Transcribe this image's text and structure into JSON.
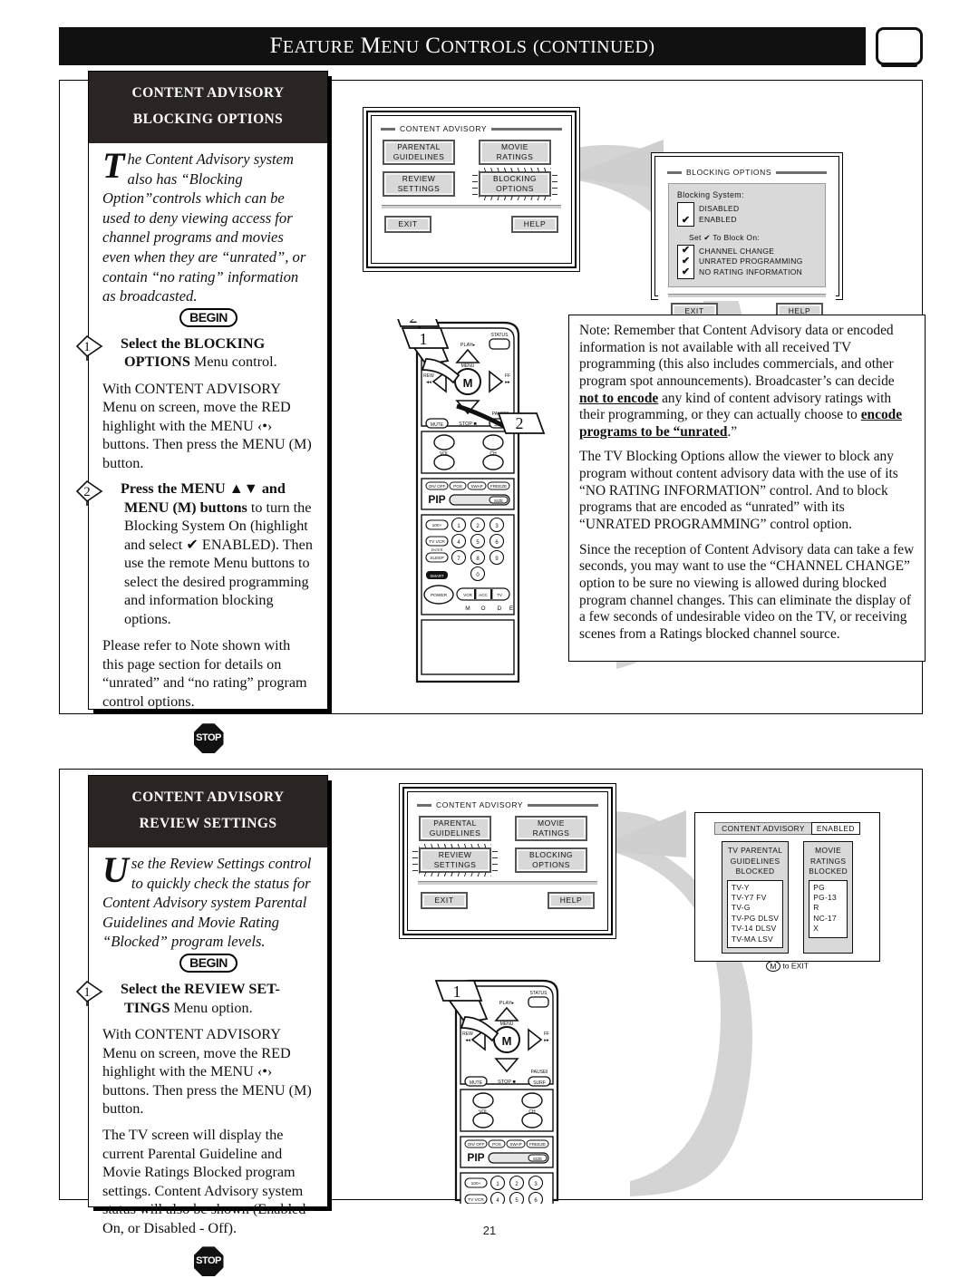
{
  "header": {
    "title_parts": [
      {
        "t": "F",
        "cap": true
      },
      {
        "t": "EATURE",
        "cap": false
      },
      {
        "t": " ",
        "cap": false
      },
      {
        "t": "M",
        "cap": true
      },
      {
        "t": "ENU",
        "cap": false
      },
      {
        "t": " ",
        "cap": false
      },
      {
        "t": "C",
        "cap": true
      },
      {
        "t": "ONTROLS",
        "cap": false
      },
      {
        "t": " (",
        "cap": false
      },
      {
        "t": "CONTINUED",
        "cap": false
      },
      {
        "t": ")",
        "cap": false
      }
    ],
    "title_text": "FEATURE MENU CONTROLS (CONTINUED)",
    "tv_icon": "tv-outline-icon"
  },
  "page_number": "21",
  "sections": [
    {
      "id": "blocking",
      "head_line1": "CONTENT ADVISORY",
      "head_line2": "BLOCKING OPTIONS",
      "intro_dropcap": "T",
      "intro_text": "he Content Advisory system also has “Blocking Option”controls which can be used to deny viewing access for channel programs and movies even when they are “unrated”, or contain “no rating” information as broadcasted.",
      "begin_label": "BEGIN",
      "stop_label": "STOP",
      "steps": [
        {
          "num": "1",
          "bold_lead": "Select the BLOCKING OPTIONS",
          "rest": " Menu control."
        },
        {
          "num": "2",
          "bold_lead": "Press the MENU ▲▼ and MENU (M) buttons",
          "rest": " to turn the Blocking System On (highlight and select ✔ ENABLED). Then use the remote Menu buttons to select the desired programming and information blocking options."
        }
      ],
      "paragraphs": [
        "With CONTENT ADVISORY Menu on screen, move the RED highlight with the MENU ‹•› buttons. Then press the MENU (M) button.",
        "Please refer to Note shown with this page section for details on “unrated” and “no rating” program control options."
      ]
    },
    {
      "id": "review",
      "head_line1": "CONTENT ADVISORY",
      "head_line2": "REVIEW SETTINGS",
      "intro_dropcap": "U",
      "intro_text": "se the Review Settings control to quickly check the status for Content Advisory system Parental Guidelines and Movie Rating “Blocked” program levels.",
      "begin_label": "BEGIN",
      "stop_label": "STOP",
      "steps": [
        {
          "num": "1",
          "bold_lead": "Select the REVIEW SET-TINGS",
          "rest": " Menu option."
        }
      ],
      "paragraphs": [
        "With CONTENT ADVISORY Menu on screen, move the RED highlight with the MENU ‹•› buttons. Then press the MENU (M) button.",
        "The TV screen will display the current Parental Guideline and Movie Ratings Blocked program settings. Content Advisory system status will also be shown (Enabled -On, or Disabled - Off)."
      ]
    }
  ],
  "osd_content_advisory": {
    "legend": "CONTENT ADVISORY",
    "buttons": [
      {
        "l1": "PARENTAL",
        "l2": "GUIDELINES"
      },
      {
        "l1": "MOVIE",
        "l2": "RATINGS"
      },
      {
        "l1": "REVIEW",
        "l2": "SETTINGS"
      },
      {
        "l1": "BLOCKING",
        "l2": "OPTIONS"
      }
    ],
    "exit": "EXIT",
    "help": "HELP",
    "selected_top": "BLOCKING OPTIONS",
    "selected_bottom": "REVIEW SETTINGS"
  },
  "osd_blocking_options": {
    "legend": "BLOCKING OPTIONS",
    "system_label": "Blocking System:",
    "system_options": [
      {
        "label": "DISABLED",
        "checked": false,
        "highlighted": false
      },
      {
        "label": "ENABLED",
        "checked": true,
        "highlighted": true
      }
    ],
    "block_on_label": "Set ✔ To Block On:",
    "block_options": [
      {
        "label": "CHANNEL CHANGE",
        "checked": true,
        "highlighted": false
      },
      {
        "label": "UNRATED PROGRAMMING",
        "checked": true,
        "highlighted": false
      },
      {
        "label": "NO RATING INFORMATION",
        "checked": true,
        "highlighted": true
      }
    ],
    "exit": "EXIT",
    "help": "HELP"
  },
  "osd_review_settings": {
    "status_label": "CONTENT ADVISORY",
    "status_value": "ENABLED",
    "tv_col": {
      "head": [
        "TV PARENTAL",
        "GUIDELINES",
        "BLOCKED"
      ],
      "items": [
        "TV-Y",
        "TV-Y7 FV",
        "TV-G",
        "TV-PG DLSV",
        "TV-14 DLSV",
        "TV-MA  LSV"
      ]
    },
    "movie_col": {
      "head": [
        "MOVIE",
        "RATINGS",
        "BLOCKED"
      ],
      "items": [
        "PG",
        "PG-13",
        "R",
        "NC-17",
        "X"
      ]
    },
    "exit_hint_icon": "M",
    "exit_hint": "to EXIT"
  },
  "note_box": {
    "paragraphs": [
      {
        "runs": [
          {
            "t": "Note: Remember that Content Advisory data or encoded information is not available with all received TV programming (this also includes commercials, and other program spot announcements). Broadcaster’s can decide ",
            "b": false
          },
          {
            "t": "not to encode",
            "b": true
          },
          {
            "t": " any kind of content advisory ratings with their programming, or they can actually choose to ",
            "b": false
          },
          {
            "t": "encode programs to be “unrated",
            "b": true
          },
          {
            "t": ".”",
            "b": false
          }
        ]
      },
      {
        "runs": [
          {
            "t": "The TV Blocking Options allow the viewer to block any program without content advisory data with the use of its “NO RATING INFORMATION” control. And to block programs that are encoded as “unrated” with its “UNRATED PROGRAMMING” control option.",
            "b": false
          }
        ]
      },
      {
        "runs": [
          {
            "t": "Since the reception of Content Advisory data can take a few seconds, you may want to use the “CHANNEL CHANGE” option to be sure no viewing is allowed during blocked program channel changes. This can eliminate the display of a few seconds of undesirable video on the TV, or receiving scenes from a Ratings blocked channel source.",
            "b": false
          }
        ]
      }
    ]
  },
  "remote": {
    "labels": {
      "play": "PLAY▸",
      "status": "STATUS",
      "rew": "REW",
      "rew_sym": "◂◂",
      "ff": "FF",
      "ff_sym": "▸▸",
      "menu": "MENU",
      "m": "M",
      "mute": "MUTE",
      "stop": "STOP",
      "stop_sym": "■",
      "pause": "PAUSE‖",
      "surf": "SURF",
      "vol": "VOL",
      "ch": "CH",
      "onoff": "ON/ OFF",
      "pos": "POS",
      "swap": "SWAP",
      "freeze": "FREEZE",
      "pip": "PIP",
      "size": "SIZE",
      "hundred": "100+",
      "tvvcr": "TV VCR",
      "enter": "ENTER",
      "sleep": "SLEEP",
      "smart": "SMART",
      "power": "POWER",
      "vcr": "VCR",
      "acc": "ACC",
      "tv": "TV",
      "mode": "M O D E",
      "digits": [
        "1",
        "2",
        "3",
        "4",
        "5",
        "6",
        "7",
        "8",
        "9",
        "0"
      ]
    },
    "callouts_top": [
      "1",
      "2",
      "2"
    ],
    "callouts_bottom": [
      "1"
    ]
  },
  "colors": {
    "header_bg": "#111111",
    "panel_head_bg": "#2a2522",
    "osd_button_face": "#d8d8d8",
    "osd_panel": "#d9d9d9",
    "swoosh": "#d4d4d4"
  }
}
